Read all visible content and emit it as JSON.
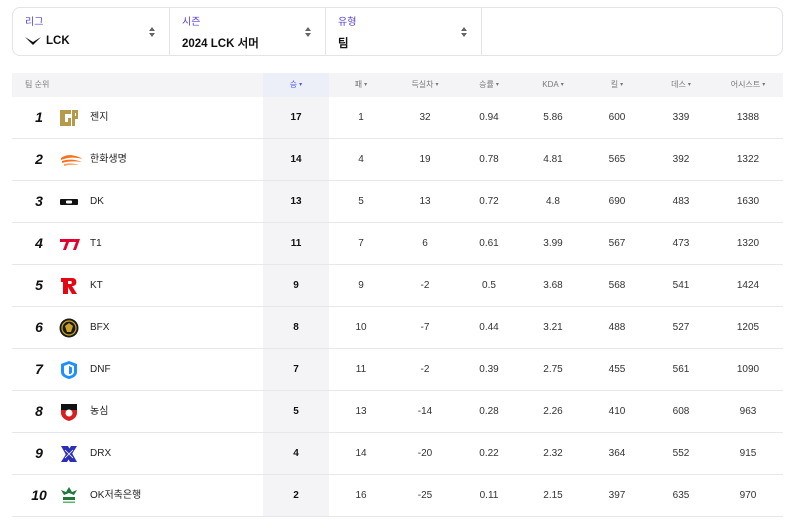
{
  "filters": {
    "league": {
      "label": "리그",
      "value": "LCK"
    },
    "season": {
      "label": "시즌",
      "value": "2024 LCK 서머"
    },
    "type": {
      "label": "유형",
      "value": "팀"
    }
  },
  "table": {
    "headers": {
      "rank": "팀 순위",
      "win": "승",
      "loss": "패",
      "diff": "득실차",
      "rate": "승률",
      "kda": "KDA",
      "kill": "킬",
      "death": "데스",
      "assist": "어시스트"
    },
    "sort_arrow": "▾",
    "rows": [
      {
        "rank": "1",
        "team": "젠지",
        "logo": "geng-logo",
        "win": "17",
        "loss": "1",
        "diff": "32",
        "rate": "0.94",
        "kda": "5.86",
        "kill": "600",
        "death": "339",
        "assist": "1388"
      },
      {
        "rank": "2",
        "team": "한화생명",
        "logo": "hanwha-logo",
        "win": "14",
        "loss": "4",
        "diff": "19",
        "rate": "0.78",
        "kda": "4.81",
        "kill": "565",
        "death": "392",
        "assist": "1322"
      },
      {
        "rank": "3",
        "team": "DK",
        "logo": "dk-logo",
        "win": "13",
        "loss": "5",
        "diff": "13",
        "rate": "0.72",
        "kda": "4.8",
        "kill": "690",
        "death": "483",
        "assist": "1630"
      },
      {
        "rank": "4",
        "team": "T1",
        "logo": "t1-logo",
        "win": "11",
        "loss": "7",
        "diff": "6",
        "rate": "0.61",
        "kda": "3.99",
        "kill": "567",
        "death": "473",
        "assist": "1320"
      },
      {
        "rank": "5",
        "team": "KT",
        "logo": "kt-logo",
        "win": "9",
        "loss": "9",
        "diff": "-2",
        "rate": "0.5",
        "kda": "3.68",
        "kill": "568",
        "death": "541",
        "assist": "1424"
      },
      {
        "rank": "6",
        "team": "BFX",
        "logo": "bfx-logo",
        "win": "8",
        "loss": "10",
        "diff": "-7",
        "rate": "0.44",
        "kda": "3.21",
        "kill": "488",
        "death": "527",
        "assist": "1205"
      },
      {
        "rank": "7",
        "team": "DNF",
        "logo": "dnf-logo",
        "win": "7",
        "loss": "11",
        "diff": "-2",
        "rate": "0.39",
        "kda": "2.75",
        "kill": "455",
        "death": "561",
        "assist": "1090"
      },
      {
        "rank": "8",
        "team": "농심",
        "logo": "ns-logo",
        "win": "5",
        "loss": "13",
        "diff": "-14",
        "rate": "0.28",
        "kda": "2.26",
        "kill": "410",
        "death": "608",
        "assist": "963"
      },
      {
        "rank": "9",
        "team": "DRX",
        "logo": "drx-logo",
        "win": "4",
        "loss": "14",
        "diff": "-20",
        "rate": "0.22",
        "kda": "2.32",
        "kill": "364",
        "death": "552",
        "assist": "915"
      },
      {
        "rank": "10",
        "team": "OK저축은행",
        "logo": "bro-logo",
        "win": "2",
        "loss": "16",
        "diff": "-25",
        "rate": "0.11",
        "kda": "2.15",
        "kill": "397",
        "death": "635",
        "assist": "970"
      }
    ]
  }
}
